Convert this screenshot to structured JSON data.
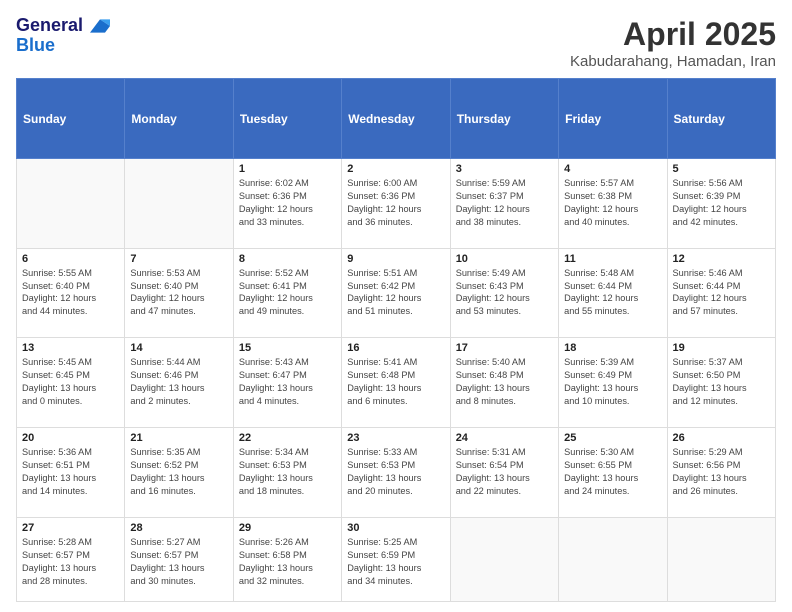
{
  "header": {
    "logo_line1": "General",
    "logo_line2": "Blue",
    "title": "April 2025",
    "subtitle": "Kabudarahang, Hamadan, Iran"
  },
  "calendar": {
    "days_of_week": [
      "Sunday",
      "Monday",
      "Tuesday",
      "Wednesday",
      "Thursday",
      "Friday",
      "Saturday"
    ],
    "weeks": [
      [
        {
          "day": "",
          "info": ""
        },
        {
          "day": "",
          "info": ""
        },
        {
          "day": "1",
          "info": "Sunrise: 6:02 AM\nSunset: 6:36 PM\nDaylight: 12 hours\nand 33 minutes."
        },
        {
          "day": "2",
          "info": "Sunrise: 6:00 AM\nSunset: 6:36 PM\nDaylight: 12 hours\nand 36 minutes."
        },
        {
          "day": "3",
          "info": "Sunrise: 5:59 AM\nSunset: 6:37 PM\nDaylight: 12 hours\nand 38 minutes."
        },
        {
          "day": "4",
          "info": "Sunrise: 5:57 AM\nSunset: 6:38 PM\nDaylight: 12 hours\nand 40 minutes."
        },
        {
          "day": "5",
          "info": "Sunrise: 5:56 AM\nSunset: 6:39 PM\nDaylight: 12 hours\nand 42 minutes."
        }
      ],
      [
        {
          "day": "6",
          "info": "Sunrise: 5:55 AM\nSunset: 6:40 PM\nDaylight: 12 hours\nand 44 minutes."
        },
        {
          "day": "7",
          "info": "Sunrise: 5:53 AM\nSunset: 6:40 PM\nDaylight: 12 hours\nand 47 minutes."
        },
        {
          "day": "8",
          "info": "Sunrise: 5:52 AM\nSunset: 6:41 PM\nDaylight: 12 hours\nand 49 minutes."
        },
        {
          "day": "9",
          "info": "Sunrise: 5:51 AM\nSunset: 6:42 PM\nDaylight: 12 hours\nand 51 minutes."
        },
        {
          "day": "10",
          "info": "Sunrise: 5:49 AM\nSunset: 6:43 PM\nDaylight: 12 hours\nand 53 minutes."
        },
        {
          "day": "11",
          "info": "Sunrise: 5:48 AM\nSunset: 6:44 PM\nDaylight: 12 hours\nand 55 minutes."
        },
        {
          "day": "12",
          "info": "Sunrise: 5:46 AM\nSunset: 6:44 PM\nDaylight: 12 hours\nand 57 minutes."
        }
      ],
      [
        {
          "day": "13",
          "info": "Sunrise: 5:45 AM\nSunset: 6:45 PM\nDaylight: 13 hours\nand 0 minutes."
        },
        {
          "day": "14",
          "info": "Sunrise: 5:44 AM\nSunset: 6:46 PM\nDaylight: 13 hours\nand 2 minutes."
        },
        {
          "day": "15",
          "info": "Sunrise: 5:43 AM\nSunset: 6:47 PM\nDaylight: 13 hours\nand 4 minutes."
        },
        {
          "day": "16",
          "info": "Sunrise: 5:41 AM\nSunset: 6:48 PM\nDaylight: 13 hours\nand 6 minutes."
        },
        {
          "day": "17",
          "info": "Sunrise: 5:40 AM\nSunset: 6:48 PM\nDaylight: 13 hours\nand 8 minutes."
        },
        {
          "day": "18",
          "info": "Sunrise: 5:39 AM\nSunset: 6:49 PM\nDaylight: 13 hours\nand 10 minutes."
        },
        {
          "day": "19",
          "info": "Sunrise: 5:37 AM\nSunset: 6:50 PM\nDaylight: 13 hours\nand 12 minutes."
        }
      ],
      [
        {
          "day": "20",
          "info": "Sunrise: 5:36 AM\nSunset: 6:51 PM\nDaylight: 13 hours\nand 14 minutes."
        },
        {
          "day": "21",
          "info": "Sunrise: 5:35 AM\nSunset: 6:52 PM\nDaylight: 13 hours\nand 16 minutes."
        },
        {
          "day": "22",
          "info": "Sunrise: 5:34 AM\nSunset: 6:53 PM\nDaylight: 13 hours\nand 18 minutes."
        },
        {
          "day": "23",
          "info": "Sunrise: 5:33 AM\nSunset: 6:53 PM\nDaylight: 13 hours\nand 20 minutes."
        },
        {
          "day": "24",
          "info": "Sunrise: 5:31 AM\nSunset: 6:54 PM\nDaylight: 13 hours\nand 22 minutes."
        },
        {
          "day": "25",
          "info": "Sunrise: 5:30 AM\nSunset: 6:55 PM\nDaylight: 13 hours\nand 24 minutes."
        },
        {
          "day": "26",
          "info": "Sunrise: 5:29 AM\nSunset: 6:56 PM\nDaylight: 13 hours\nand 26 minutes."
        }
      ],
      [
        {
          "day": "27",
          "info": "Sunrise: 5:28 AM\nSunset: 6:57 PM\nDaylight: 13 hours\nand 28 minutes."
        },
        {
          "day": "28",
          "info": "Sunrise: 5:27 AM\nSunset: 6:57 PM\nDaylight: 13 hours\nand 30 minutes."
        },
        {
          "day": "29",
          "info": "Sunrise: 5:26 AM\nSunset: 6:58 PM\nDaylight: 13 hours\nand 32 minutes."
        },
        {
          "day": "30",
          "info": "Sunrise: 5:25 AM\nSunset: 6:59 PM\nDaylight: 13 hours\nand 34 minutes."
        },
        {
          "day": "",
          "info": ""
        },
        {
          "day": "",
          "info": ""
        },
        {
          "day": "",
          "info": ""
        }
      ]
    ]
  }
}
